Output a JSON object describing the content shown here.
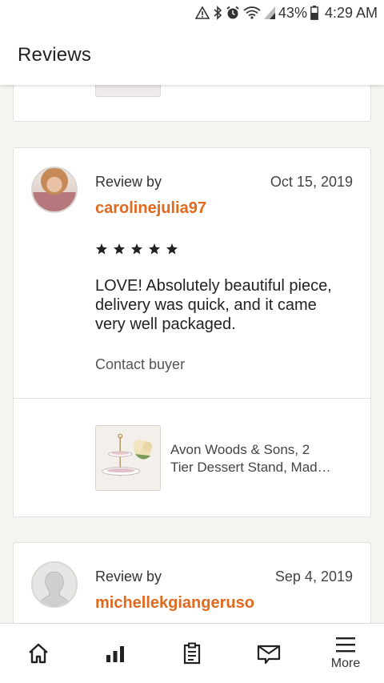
{
  "status_bar": {
    "battery_percent": "43%",
    "time": "4:29 AM",
    "icons": [
      "warning-icon",
      "bluetooth-icon",
      "alarm-icon",
      "wifi-icon",
      "signal-icon",
      "battery-icon"
    ]
  },
  "header": {
    "title": "Reviews"
  },
  "reviews": [
    {
      "review_by_label": "Review by",
      "username": "carolinejulia97",
      "date": "Oct 15, 2019",
      "rating": 5,
      "text": "LOVE! Absolutely beautiful piece, delivery was quick, and it came very well packaged.",
      "contact_label": "Contact buyer",
      "product": {
        "title_line1": "Avon Woods & Sons, 2",
        "title_line2": "Tier Dessert Stand, Mad…"
      }
    },
    {
      "review_by_label": "Review by",
      "username": "michellekgiangeruso",
      "date": "Sep 4, 2019"
    }
  ],
  "bottom_nav": {
    "items": [
      {
        "icon": "home-icon",
        "label": ""
      },
      {
        "icon": "stats-icon",
        "label": ""
      },
      {
        "icon": "orders-icon",
        "label": ""
      },
      {
        "icon": "messages-icon",
        "label": ""
      },
      {
        "icon": "menu-icon",
        "label": "More"
      }
    ]
  },
  "colors": {
    "accent": "#e0691d",
    "background": "#f5f4f0",
    "card": "#ffffff",
    "star": "#222222"
  }
}
